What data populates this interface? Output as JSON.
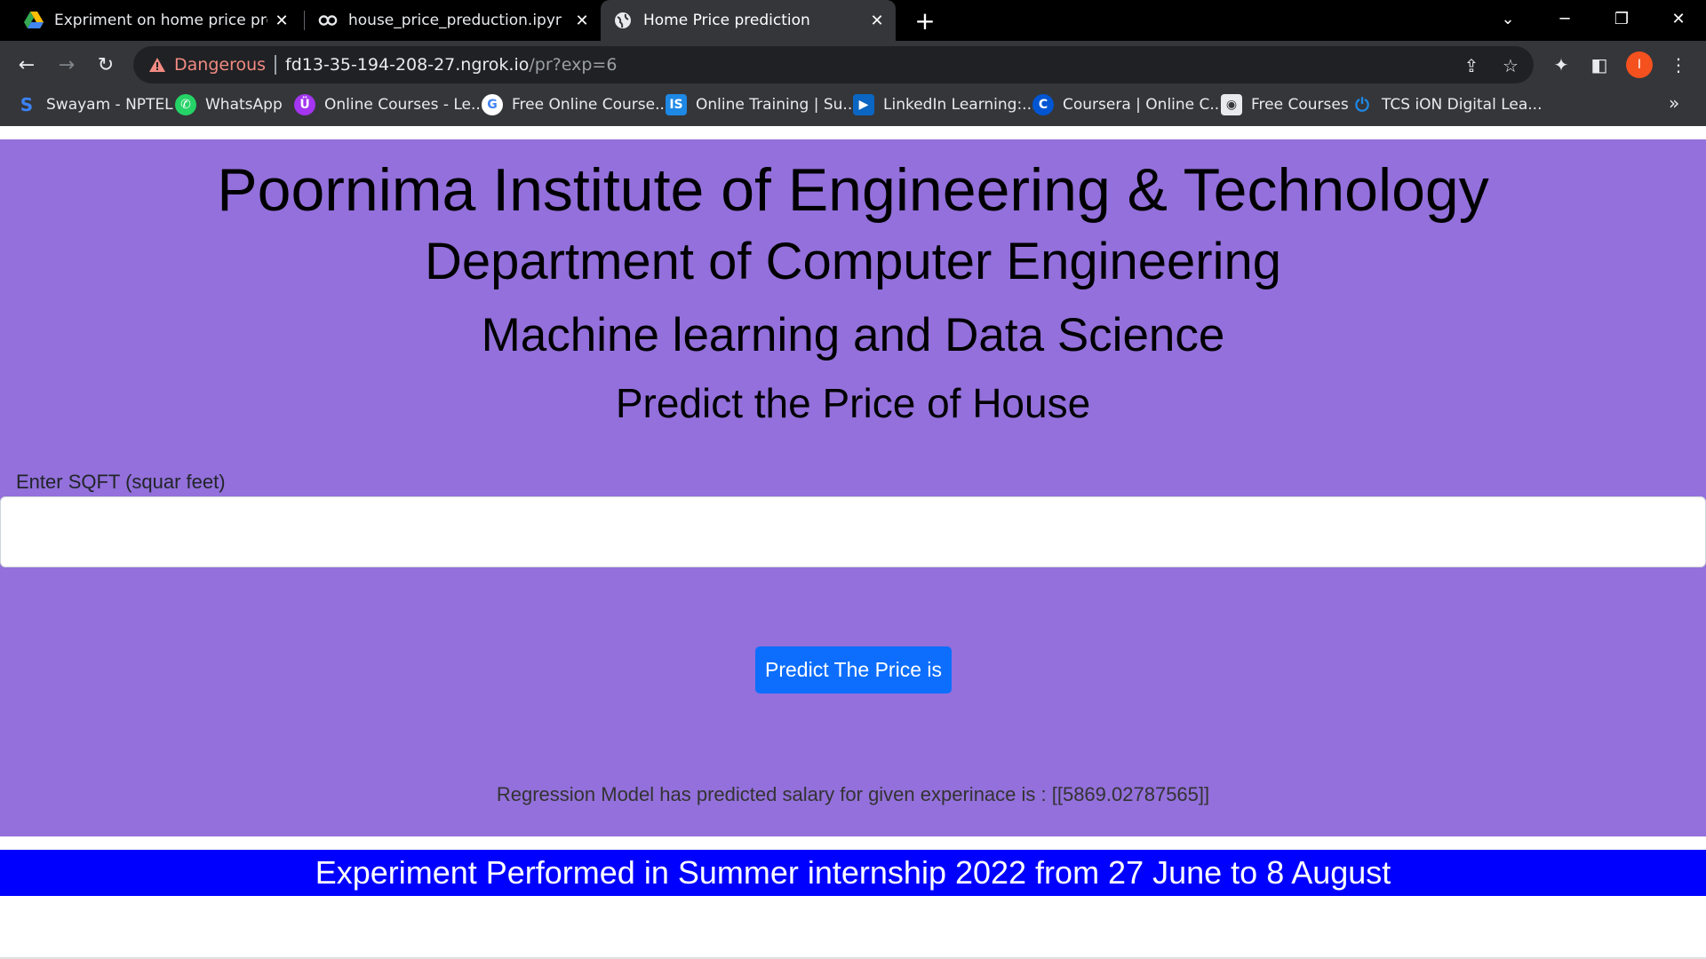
{
  "browser": {
    "tabs": [
      {
        "title": "Expriment on home price predict",
        "icon": "google-drive-icon",
        "active": false
      },
      {
        "title": "house_price_preduction.ipynb - C",
        "icon": "colab-icon",
        "active": false
      },
      {
        "title": "Home Price prediction",
        "icon": "globe-icon",
        "active": true
      }
    ],
    "security_label": "Dangerous",
    "url_host": "fd13-35-194-208-27.ngrok.io",
    "url_path": "/pr?exp=6",
    "profile_initial": "I",
    "bookmarks": [
      {
        "label": "Swayam - NPTEL",
        "icon": "swayam-icon"
      },
      {
        "label": "WhatsApp",
        "icon": "whatsapp-icon"
      },
      {
        "label": "Online Courses - Le...",
        "icon": "udemy-icon"
      },
      {
        "label": "Free Online Course...",
        "icon": "google-icon"
      },
      {
        "label": "Online Training | Su...",
        "icon": "is-icon"
      },
      {
        "label": "LinkedIn Learning:...",
        "icon": "linkedin-learning-icon"
      },
      {
        "label": "Coursera | Online C...",
        "icon": "coursera-icon"
      },
      {
        "label": "Free Courses",
        "icon": "shield-icon"
      },
      {
        "label": "TCS iON Digital Lea...",
        "icon": "power-icon"
      }
    ],
    "bookmarks_more": "»"
  },
  "page": {
    "heading1": "Poornima Institute of Engineering & Technology",
    "heading2": "Department of Computer Engineering",
    "heading3": "Machine learning and Data Science",
    "heading4": "Predict the Price of House",
    "sqft_label": "Enter SQFT (squar feet)",
    "sqft_value": "",
    "predict_button": "Predict The Price is",
    "result_text": "Regression Model has predicted salary for given experinace is : [[5869.02787565]]",
    "footer_text": "Experiment Performed in Summer internship 2022 from 27 June to 8 August"
  },
  "colors": {
    "hero_bg": "#9370db",
    "button_bg": "#0d6efd",
    "footer_bg": "#0000ff",
    "danger": "#f28b82"
  }
}
